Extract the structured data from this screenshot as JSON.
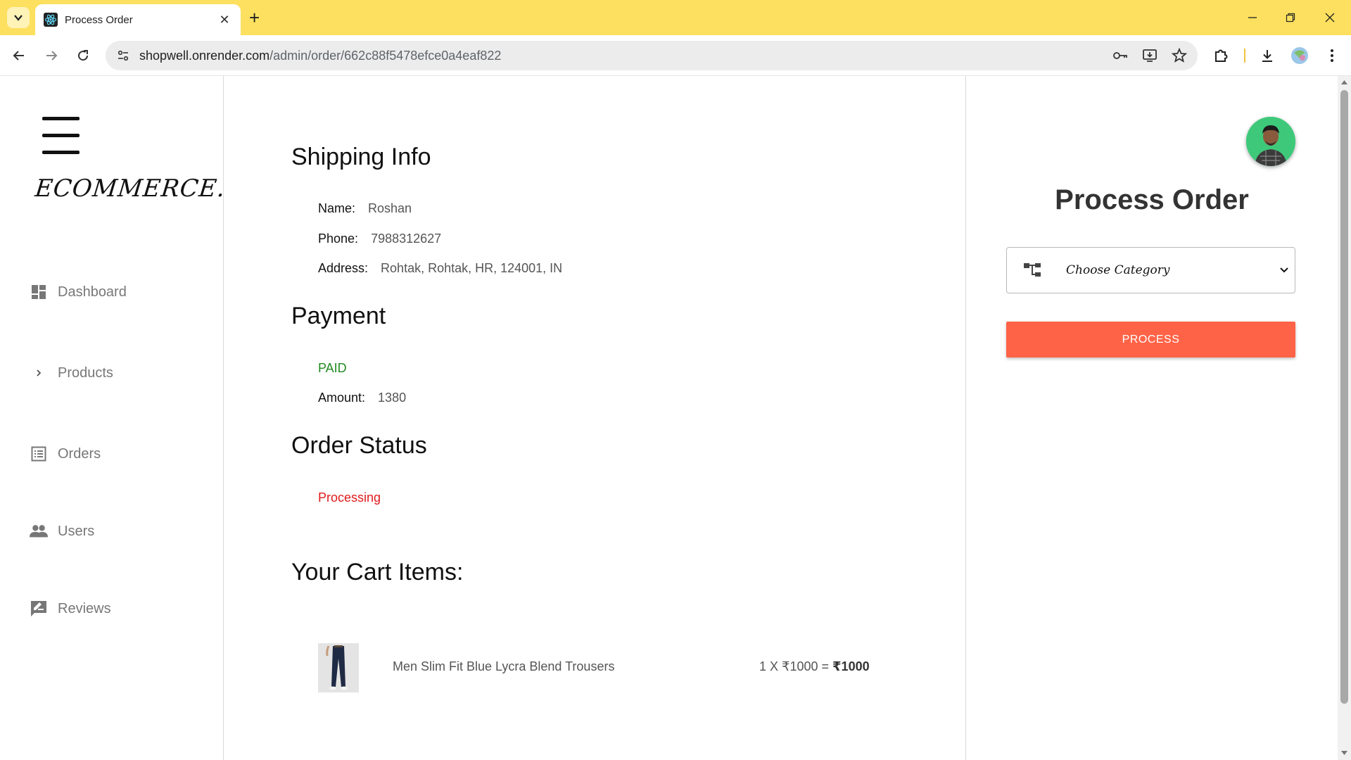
{
  "browser": {
    "tab_title": "Process Order",
    "url_host": "shopwell.onrender.com",
    "url_path": "/admin/order/662c88f5478efce0a4eaf822"
  },
  "sidebar": {
    "brand": "ECOMMERCE.",
    "items": [
      {
        "label": "Dashboard",
        "icon": "dashboard-icon"
      },
      {
        "label": "Products",
        "icon": "chevron-right-icon"
      },
      {
        "label": "Orders",
        "icon": "list-icon"
      },
      {
        "label": "Users",
        "icon": "people-icon"
      },
      {
        "label": "Reviews",
        "icon": "rate-review-icon"
      }
    ]
  },
  "order": {
    "shipping_title": "Shipping Info",
    "name_label": "Name:",
    "name": "Roshan",
    "phone_label": "Phone:",
    "phone": "7988312627",
    "address_label": "Address:",
    "address": "Rohtak, Rohtak, HR, 124001, IN",
    "payment_title": "Payment",
    "payment_status": "PAID",
    "amount_label": "Amount:",
    "amount": "1380",
    "status_title": "Order Status",
    "status": "Processing",
    "cart_title": "Your Cart Items:",
    "items": [
      {
        "name": "Men Slim Fit Blue Lycra Blend Trousers",
        "qty_price": "1 X ₹1000 = ",
        "total": "₹1000"
      }
    ]
  },
  "process_panel": {
    "title": "Process Order",
    "select_placeholder": "Choose Category",
    "button_label": "PROCESS"
  },
  "colors": {
    "tabbar": "#fde05f",
    "paid": "#228b22",
    "status": "#e01b1b",
    "button": "#ff6347"
  }
}
